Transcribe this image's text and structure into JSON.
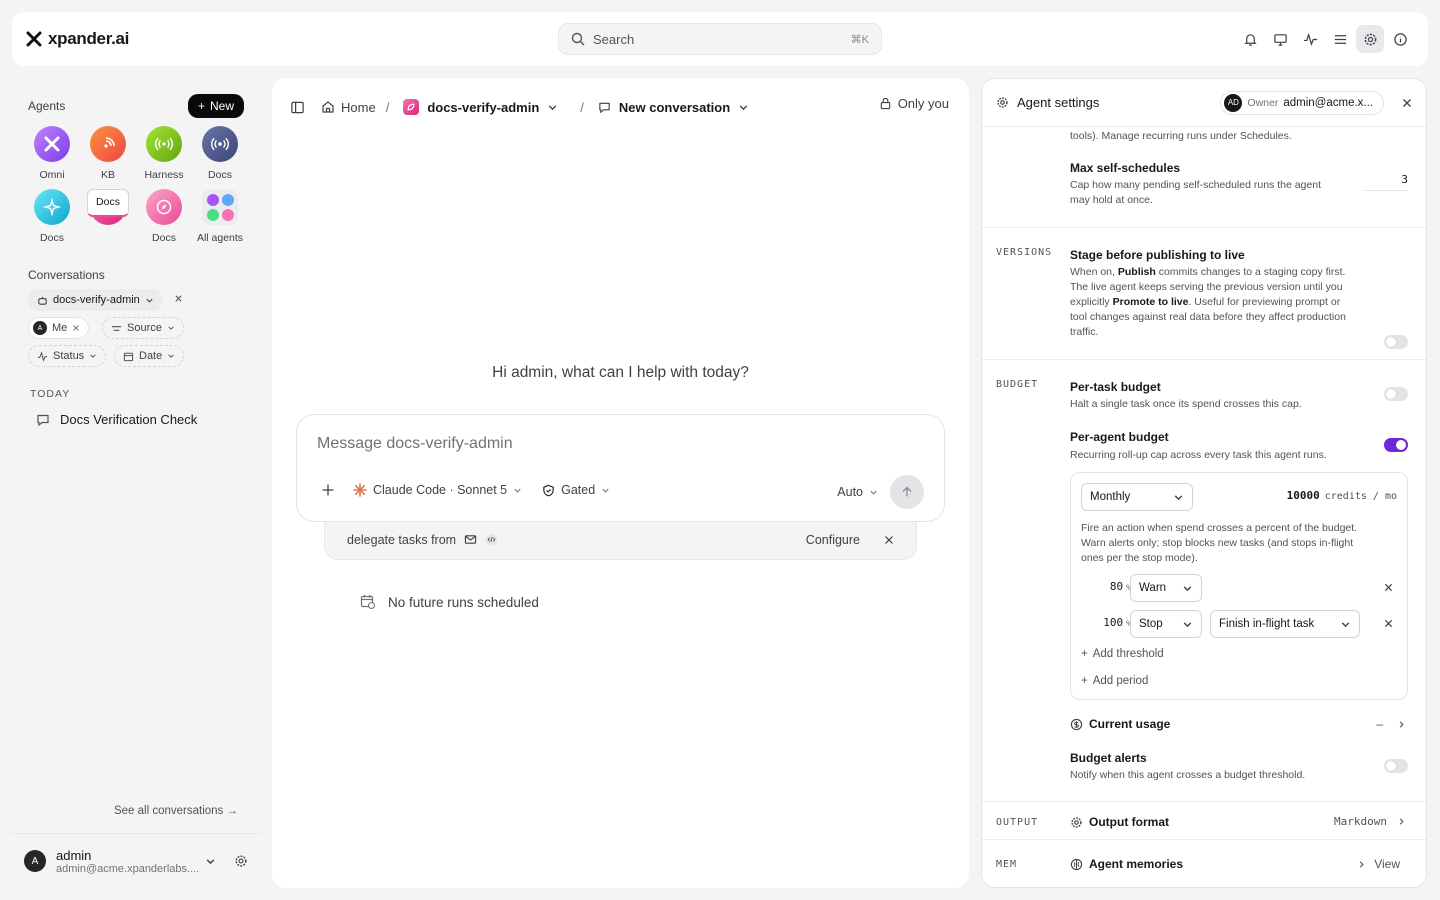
{
  "brand": {
    "name": "xpander.ai"
  },
  "search": {
    "placeholder": "Search",
    "shortcut": "⌘K"
  },
  "topbar_icons": [
    "bell-icon",
    "monitor-icon",
    "activity-icon",
    "list-icon",
    "gear-icon",
    "info-icon"
  ],
  "sidebar": {
    "agents_title": "Agents",
    "new_label": "New",
    "agents": [
      {
        "label": "Omni",
        "color": "#a855f7",
        "icon": "omni-icon"
      },
      {
        "label": "KB",
        "color": "#f97316",
        "icon": "broadcast-icon"
      },
      {
        "label": "Harness",
        "color": "#84cc16",
        "icon": "radio-icon"
      },
      {
        "label": "Docs",
        "color": "#4f5b93",
        "icon": "radio-icon"
      },
      {
        "label": "Docs",
        "color": "#22c5e0",
        "icon": "sparkle-icon"
      },
      {
        "label": "Docs",
        "color": "#ec4899",
        "icon": "leaf-icon",
        "selected": true
      },
      {
        "label": "Docs",
        "color": "#f06a9a",
        "icon": "compass-icon"
      },
      {
        "label": "All agents",
        "icon": "grid-icon"
      }
    ],
    "conversations_title": "Conversations",
    "filter_agent": "docs-verify-admin",
    "filter_me": "Me",
    "filter_me_avatar": "A",
    "filter_source": "Source",
    "filter_status": "Status",
    "filter_date": "Date",
    "today_label": "TODAY",
    "conversation_item": "Docs Verification Check",
    "see_all": "See all conversations →",
    "user": {
      "name": "admin",
      "email": "admin@acme.xpanderlabs....",
      "avatar": "A"
    }
  },
  "main": {
    "breadcrumb_home": "Home",
    "breadcrumb_agent": "docs-verify-admin",
    "breadcrumb_conversation": "New conversation",
    "visibility": "Only you",
    "greeting": "Hi admin, what can I help with today?",
    "composer_placeholder": "Message docs-verify-admin",
    "model": "Claude Code · Sonnet 5",
    "gate": "Gated",
    "mode": "Auto",
    "delegate_text": "delegate tasks from",
    "configure": "Configure",
    "no_runs": "No future runs scheduled"
  },
  "panel": {
    "title": "Agent settings",
    "owner_label": "Owner",
    "owner_email": "admin@acme.x...",
    "owner_avatar": "AD",
    "top_text": "tools). Manage recurring runs under Schedules.",
    "max_self_title": "Max self-schedules",
    "max_self_desc_1": "Cap how many pending self-scheduled runs the agent",
    "max_self_desc_2": "may hold at once.",
    "max_self_value": "3",
    "versions_label": "VERSIONS",
    "stage_title": "Stage before publishing to live",
    "stage_desc_1a": "When on, ",
    "stage_desc_1b": "Publish",
    "stage_desc_1c": " commits changes to a staging copy first.",
    "stage_desc_2": "The live agent keeps serving the previous version until you",
    "stage_desc_3a": "explicitly ",
    "stage_desc_3b": "Promote to live",
    "stage_desc_3c": ". Useful for previewing prompt or",
    "stage_desc_4": "tool changes against real data before they affect production",
    "stage_desc_5": "traffic.",
    "budget_label": "BUDGET",
    "per_task_title": "Per-task budget",
    "per_task_desc": "Halt a single task once its spend crosses this cap.",
    "per_agent_title": "Per-agent budget",
    "per_agent_desc": "Recurring roll-up cap across every task this agent runs.",
    "period": "Monthly",
    "credits_value": "10000",
    "credits_unit": "credits / mo",
    "threshold_desc_1": "Fire an action when spend crosses a percent of the budget.",
    "threshold_desc_2": "Warn alerts only; stop blocks new tasks (and stops in-flight",
    "threshold_desc_3": "ones per the stop mode).",
    "threshold_1_pct": "80",
    "threshold_1_action": "Warn",
    "threshold_2_pct": "100",
    "threshold_2_action": "Stop",
    "threshold_2_mode": "Finish in-flight task",
    "pct_sign": "%",
    "add_threshold": "Add threshold",
    "add_period": "Add period",
    "current_usage": "Current usage",
    "current_usage_value": "–",
    "budget_alerts_title": "Budget alerts",
    "budget_alerts_desc": "Notify when this agent crosses a budget threshold.",
    "output_label": "OUTPUT",
    "output_format": "Output format",
    "output_value": "Markdown",
    "mem_label": "MEM",
    "agent_memories": "Agent memories",
    "view": "View"
  },
  "colors": {
    "accent": "#6d28d9",
    "selected_underline": "#ec4899"
  }
}
